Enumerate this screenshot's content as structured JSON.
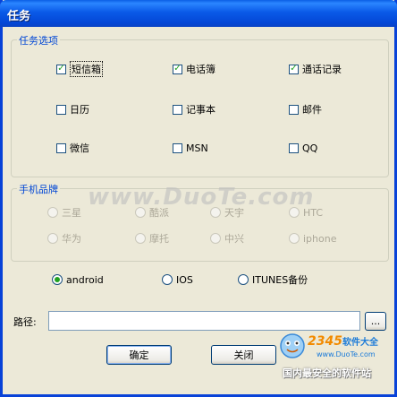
{
  "window": {
    "title": "任务"
  },
  "task_options": {
    "legend": "任务选项",
    "items": [
      {
        "label": "短信箱",
        "checked": true
      },
      {
        "label": "电话簿",
        "checked": true
      },
      {
        "label": "通话记录",
        "checked": true
      },
      {
        "label": "日历",
        "checked": false
      },
      {
        "label": "记事本",
        "checked": false
      },
      {
        "label": "邮件",
        "checked": false
      },
      {
        "label": "微信",
        "checked": false
      },
      {
        "label": "MSN",
        "checked": false
      },
      {
        "label": "QQ",
        "checked": false
      }
    ]
  },
  "brands": {
    "legend": "手机品牌",
    "items": [
      {
        "label": "三星"
      },
      {
        "label": "酷派"
      },
      {
        "label": "天宇"
      },
      {
        "label": "HTC"
      },
      {
        "label": "华为"
      },
      {
        "label": "摩托"
      },
      {
        "label": "中兴"
      },
      {
        "label": "iphone"
      }
    ]
  },
  "platforms": {
    "selected": "android",
    "items": [
      {
        "label": "android"
      },
      {
        "label": "IOS"
      },
      {
        "label": "ITUNES备份"
      }
    ]
  },
  "path": {
    "label": "路径:",
    "value": "",
    "browse_label": "..."
  },
  "buttons": {
    "ok_label": "确定",
    "close_label": "关闭"
  },
  "watermark": {
    "text": "www.DuoTe.com"
  },
  "logo": {
    "brand_num": "2345",
    "brand_cn": "软件大全",
    "site": "www.DuoTe.com",
    "slogan": "国内最安全的软件站"
  },
  "colors": {
    "check": "#21a121",
    "legend": "#0046d5",
    "title_bar": "#0a5ae8"
  }
}
